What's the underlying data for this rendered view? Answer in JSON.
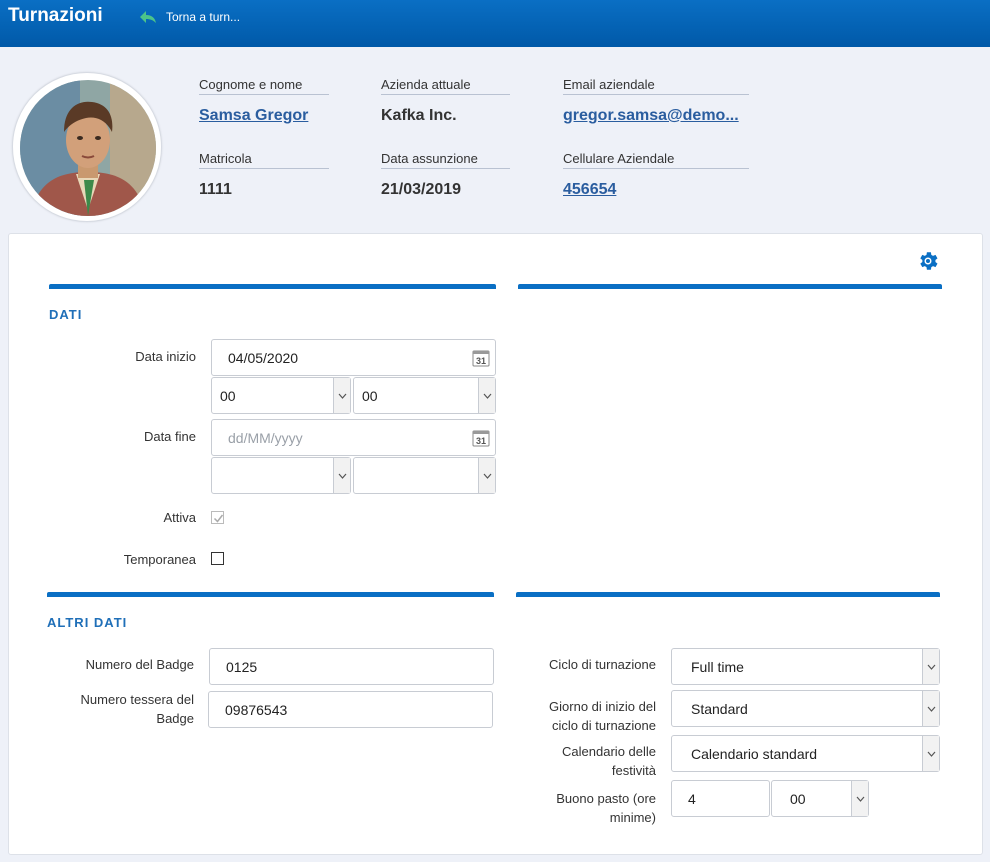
{
  "header": {
    "title": "Turnazioni",
    "back_label": "Torna a turn..."
  },
  "profile": {
    "name_label": "Cognome e nome",
    "name_value": "Samsa Gregor",
    "company_label": "Azienda attuale",
    "company_value": "Kafka Inc.",
    "email_label": "Email aziendale",
    "email_value": "gregor.samsa@demo...",
    "id_label": "Matricola",
    "id_value": "1111",
    "hire_label": "Data assunzione",
    "hire_value": "21/03/2019",
    "phone_label": "Cellulare Aziendale",
    "phone_value": "456654"
  },
  "dati": {
    "title": "DATI",
    "start_label": "Data inizio",
    "start_date": "04/05/2020",
    "start_hour": "00",
    "start_minute": "00",
    "end_label": "Data fine",
    "end_placeholder": "dd/MM/yyyy",
    "end_hour": "",
    "end_minute": "",
    "active_label": "Attiva",
    "active_checked": true,
    "temp_label": "Temporanea",
    "temp_checked": false,
    "calendar_day": "31"
  },
  "altri": {
    "title": "ALTRI DATI",
    "badge_label": "Numero del Badge",
    "badge_value": "0125",
    "card_label": "Numero tessera del Badge",
    "card_value": "09876543",
    "cycle_label": "Ciclo di turnazione",
    "cycle_value": "Full time",
    "cycle_start_label": "Giorno di inizio del ciclo di turnazione",
    "cycle_start_value": "Standard",
    "holiday_label": "Calendario delle festività",
    "holiday_value": "Calendario standard",
    "meal_label": "Buono pasto (ore minime)",
    "meal_hours": "4",
    "meal_minutes": "00"
  },
  "colors": {
    "brand": "#0a6fc4",
    "link": "#2a5d9f",
    "background": "#eef1f8"
  },
  "icons": [
    "back-arrow-icon",
    "gear-icon",
    "calendar-icon",
    "chevron-down-icon",
    "checkmark-icon"
  ]
}
